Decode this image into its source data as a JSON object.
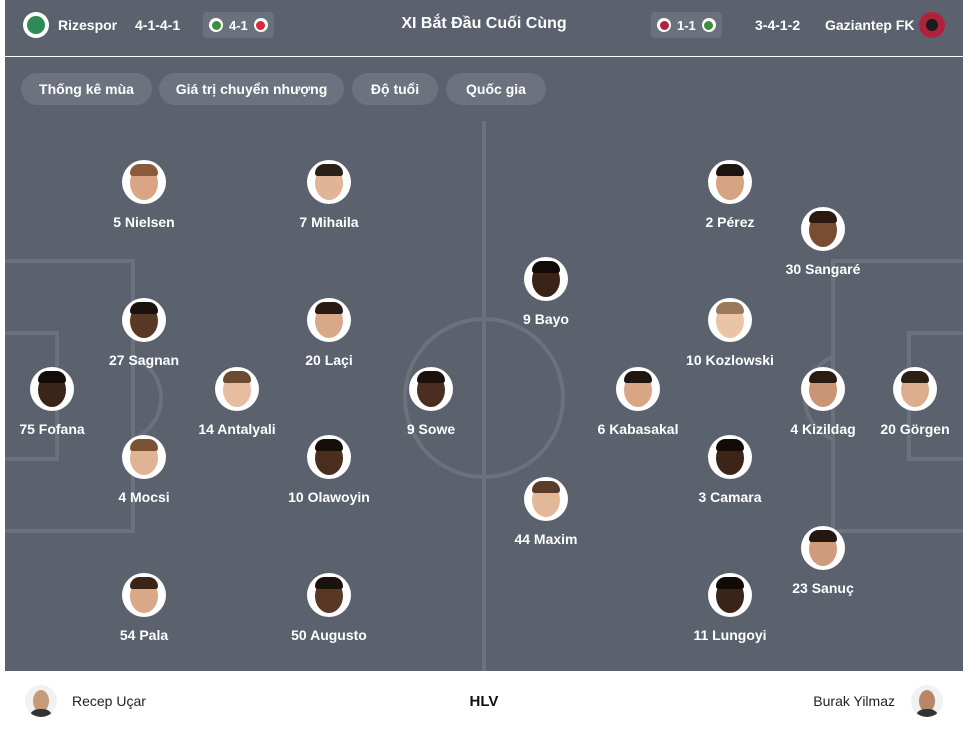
{
  "header": {
    "home_team": "Rizespor",
    "home_formation": "4-1-4-1",
    "home_result": "4-1",
    "title": "XI Bắt Đầu Cuối Cùng",
    "away_result": "1-1",
    "away_formation": "3-4-1-2",
    "away_team": "Gaziantep FK",
    "colors": {
      "home": "#2e8b57",
      "away": "#b0223c",
      "opponent_red": "#d9293f",
      "opponent_green": "#3f8f3a"
    }
  },
  "filters": [
    "Thống kê mùa",
    "Giá trị chuyển nhượng",
    "Độ tuổi",
    "Quốc gia"
  ],
  "home_players": [
    {
      "label": "5 Nielsen"
    },
    {
      "label": "7 Mihaila"
    },
    {
      "label": "27 Sagnan"
    },
    {
      "label": "20 Laçi"
    },
    {
      "label": "75 Fofana"
    },
    {
      "label": "14 Antalyali"
    },
    {
      "label": "9 Sowe"
    },
    {
      "label": "4 Mocsi"
    },
    {
      "label": "10 Olawoyin"
    },
    {
      "label": "54 Pala"
    },
    {
      "label": "50 Augusto"
    }
  ],
  "away_players": [
    {
      "label": "2 Pérez"
    },
    {
      "label": "30 Sangaré"
    },
    {
      "label": "9 Bayo"
    },
    {
      "label": "10 Kozlowski"
    },
    {
      "label": "6 Kabasakal"
    },
    {
      "label": "4 Kizildag"
    },
    {
      "label": "20 Görgen"
    },
    {
      "label": "3 Camara"
    },
    {
      "label": "44 Maxim"
    },
    {
      "label": "23 Sanuç"
    },
    {
      "label": "11 Lungoyi"
    }
  ],
  "coaches": {
    "home": "Recep Uçar",
    "label": "HLV",
    "away": "Burak Yilmaz"
  }
}
